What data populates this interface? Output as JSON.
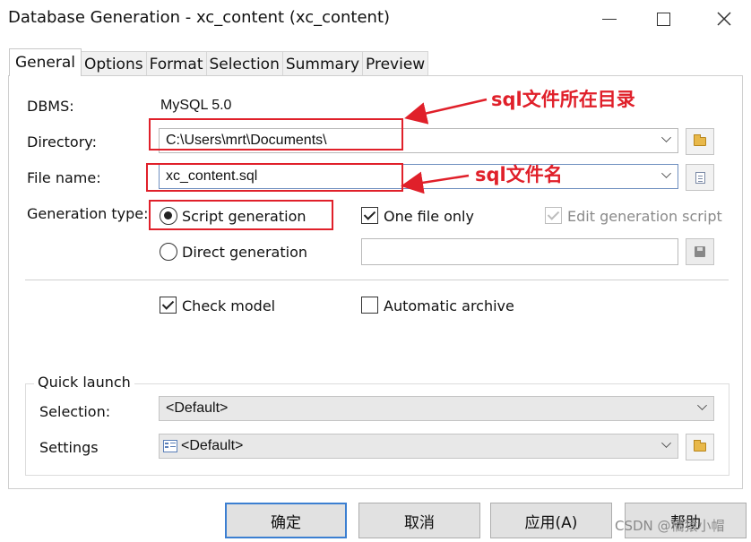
{
  "window": {
    "title": "Database Generation - xc_content (xc_content)"
  },
  "tabs": [
    {
      "label": "General",
      "active": true
    },
    {
      "label": "Options",
      "active": false
    },
    {
      "label": "Format",
      "active": false
    },
    {
      "label": "Selection",
      "active": false
    },
    {
      "label": "Summary",
      "active": false
    },
    {
      "label": "Preview",
      "active": false
    }
  ],
  "general": {
    "dbms_label": "DBMS:",
    "dbms_value": "MySQL 5.0",
    "directory_label": "Directory:",
    "directory_value": "C:\\Users\\mrt\\Documents\\",
    "filename_label": "File name:",
    "filename_value": "xc_content.sql",
    "generation_type_label": "Generation type:",
    "script_generation_label": "Script generation",
    "script_generation_selected": true,
    "direct_generation_label": "Direct generation",
    "direct_generation_selected": false,
    "one_file_only_label": "One file only",
    "one_file_only_checked": true,
    "edit_script_label": "Edit generation script",
    "edit_script_checked": true,
    "direct_generation_value": "",
    "check_model_label": "Check model",
    "check_model_checked": true,
    "automatic_archive_label": "Automatic archive",
    "automatic_archive_checked": false
  },
  "quick_launch": {
    "title": "Quick launch",
    "selection_label": "Selection:",
    "selection_value": "<Default>",
    "settings_label": "Settings",
    "settings_value": "<Default>"
  },
  "annotations": {
    "directory_note": "sql文件所在目录",
    "filename_note": "sql文件名",
    "color": "#e0202a"
  },
  "buttons": {
    "ok": "确定",
    "cancel": "取消",
    "apply": "应用(A)",
    "help": "帮助"
  },
  "watermark": "CSDN @橘猿小帽"
}
